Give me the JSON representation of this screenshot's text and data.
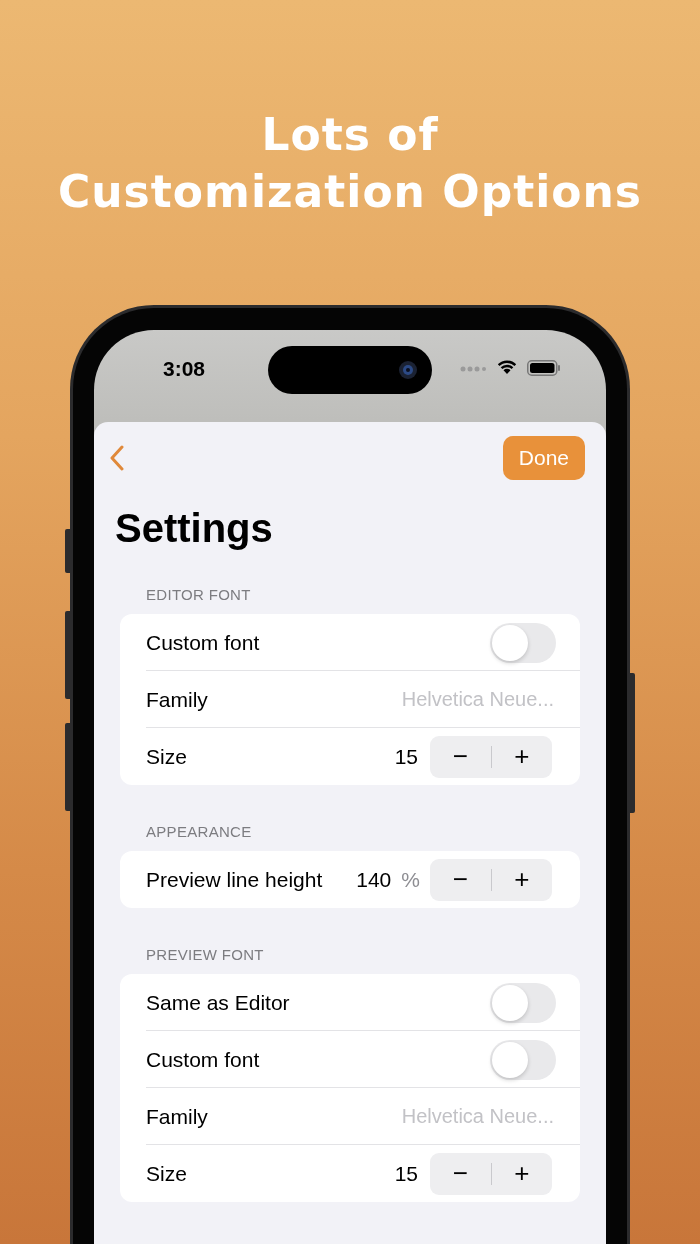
{
  "headline": [
    "Lots of",
    "Customization Options"
  ],
  "status_bar": {
    "time": "3:08"
  },
  "nav": {
    "done_button": "Done"
  },
  "title": "Settings",
  "sections": [
    {
      "header": "EDITOR FONT",
      "rows": [
        {
          "kind": "toggle",
          "label": "Custom font",
          "on": false
        },
        {
          "kind": "value",
          "label": "Family",
          "value": "Helvetica Neue..."
        },
        {
          "kind": "stepper",
          "label": "Size",
          "value": "15",
          "minus": "−",
          "plus": "+"
        }
      ]
    },
    {
      "header": "APPEARANCE",
      "rows": [
        {
          "kind": "stepper",
          "label": "Preview line height",
          "value": "140",
          "unit": "%",
          "minus": "−",
          "plus": "+"
        }
      ]
    },
    {
      "header": "PREVIEW FONT",
      "rows": [
        {
          "kind": "toggle",
          "label": "Same as Editor",
          "on": false
        },
        {
          "kind": "toggle",
          "label": "Custom font",
          "on": false
        },
        {
          "kind": "value",
          "label": "Family",
          "value": "Helvetica Neue..."
        },
        {
          "kind": "stepper",
          "label": "Size",
          "value": "15",
          "minus": "−",
          "plus": "+"
        }
      ]
    }
  ]
}
